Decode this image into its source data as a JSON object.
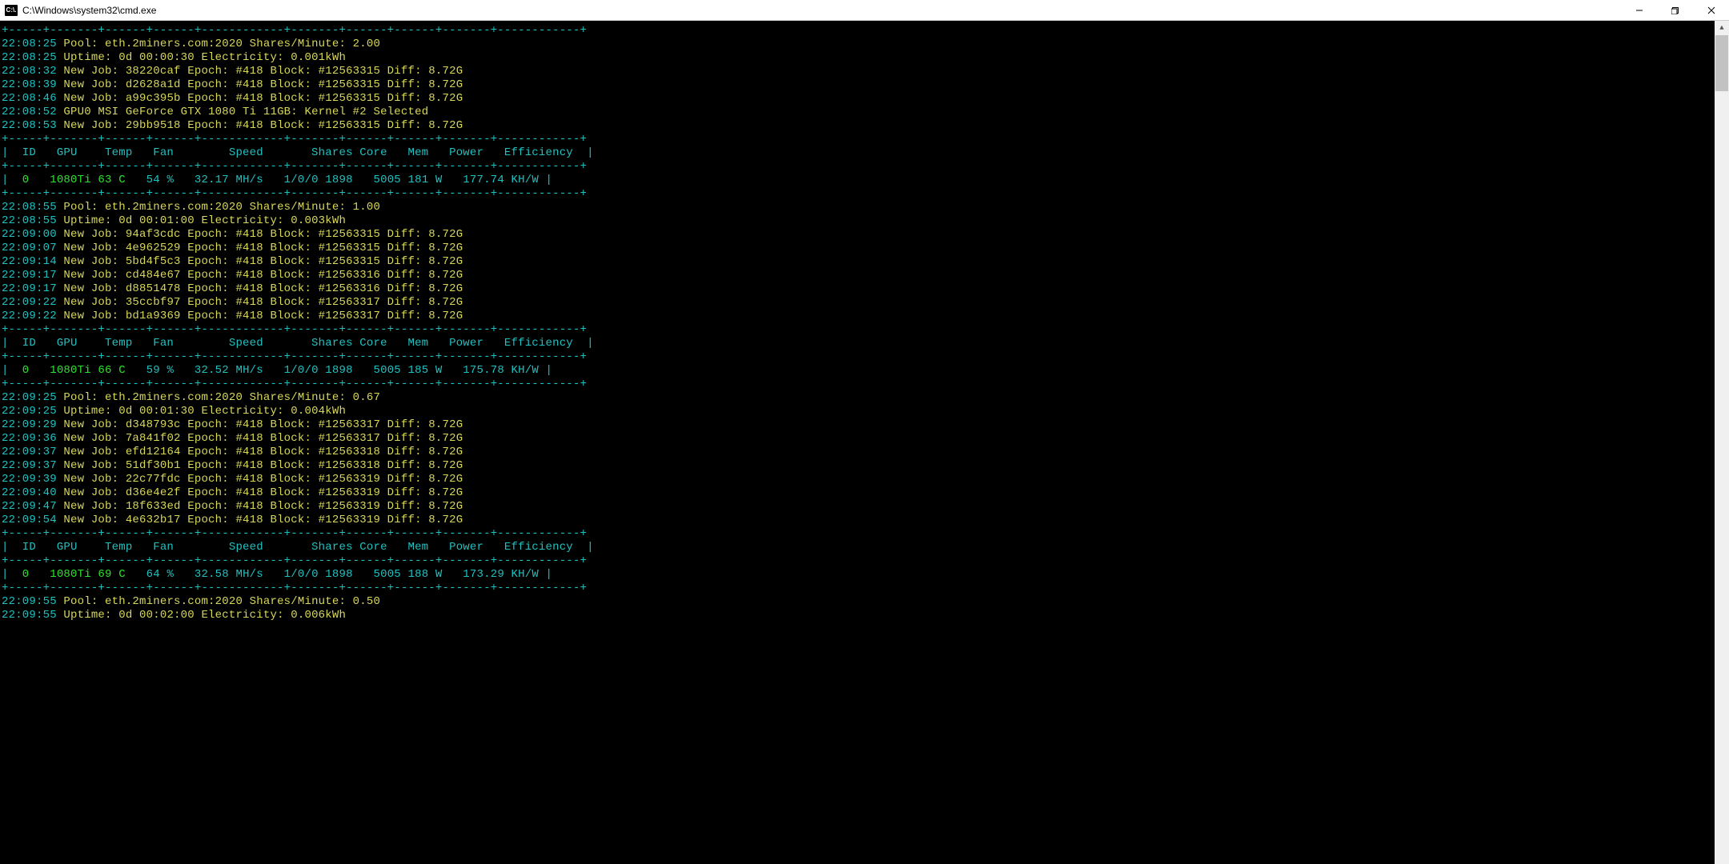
{
  "window": {
    "icon_text": "C:\\.",
    "title": "C:\\Windows\\system32\\cmd.exe"
  },
  "tableBorder": {
    "top": "+-----+-------+------+------+------------+-------+------+------+-------+------------+",
    "header": "|  ID   GPU    Temp   Fan        Speed       Shares Core   Mem   Power   Efficiency  |",
    "mid": "+-----+-------+------+------+------------+-------+------+------+-------+------------+",
    "bot": "+-----+-------+------+------+------------+-------+------+------+-------+------------+"
  },
  "segments": [
    {
      "pool": {
        "ts": "22:08:25",
        "text": "Pool: eth.2miners.com:2020 Shares/Minute: 2.00"
      },
      "uptime": {
        "ts": "22:08:25",
        "text": "Uptime: 0d 00:00:30 Electricity: 0.001kWh"
      },
      "jobs": [
        {
          "ts": "22:08:32",
          "text": "New Job: 38220caf Epoch: #418 Block: #12563315 Diff: 8.72G"
        },
        {
          "ts": "22:08:39",
          "text": "New Job: d2628a1d Epoch: #418 Block: #12563315 Diff: 8.72G"
        },
        {
          "ts": "22:08:46",
          "text": "New Job: a99c395b Epoch: #418 Block: #12563315 Diff: 8.72G"
        },
        {
          "ts": "22:08:52",
          "text": "GPU0 MSI GeForce GTX 1080 Ti 11GB: Kernel #2 Selected"
        },
        {
          "ts": "22:08:53",
          "text": "New Job: 29bb9518 Epoch: #418 Block: #12563315 Diff: 8.72G"
        }
      ],
      "row": {
        "id": "0",
        "gpu": "1080Ti",
        "temp": "63 C",
        "fan": "54 %",
        "speed": "32.17 MH/s",
        "shares": "1/0/0",
        "core": "1898",
        "mem": "5005",
        "power": "181 W",
        "eff": "177.74 KH/W"
      }
    },
    {
      "pool": {
        "ts": "22:08:55",
        "text": "Pool: eth.2miners.com:2020 Shares/Minute: 1.00"
      },
      "uptime": {
        "ts": "22:08:55",
        "text": "Uptime: 0d 00:01:00 Electricity: 0.003kWh"
      },
      "jobs": [
        {
          "ts": "22:09:00",
          "text": "New Job: 94af3cdc Epoch: #418 Block: #12563315 Diff: 8.72G"
        },
        {
          "ts": "22:09:07",
          "text": "New Job: 4e962529 Epoch: #418 Block: #12563315 Diff: 8.72G"
        },
        {
          "ts": "22:09:14",
          "text": "New Job: 5bd4f5c3 Epoch: #418 Block: #12563315 Diff: 8.72G"
        },
        {
          "ts": "22:09:17",
          "text": "New Job: cd484e67 Epoch: #418 Block: #12563316 Diff: 8.72G"
        },
        {
          "ts": "22:09:17",
          "text": "New Job: d8851478 Epoch: #418 Block: #12563316 Diff: 8.72G"
        },
        {
          "ts": "22:09:22",
          "text": "New Job: 35ccbf97 Epoch: #418 Block: #12563317 Diff: 8.72G"
        },
        {
          "ts": "22:09:22",
          "text": "New Job: bd1a9369 Epoch: #418 Block: #12563317 Diff: 8.72G"
        }
      ],
      "row": {
        "id": "0",
        "gpu": "1080Ti",
        "temp": "66 C",
        "fan": "59 %",
        "speed": "32.52 MH/s",
        "shares": "1/0/0",
        "core": "1898",
        "mem": "5005",
        "power": "185 W",
        "eff": "175.78 KH/W"
      }
    },
    {
      "pool": {
        "ts": "22:09:25",
        "text": "Pool: eth.2miners.com:2020 Shares/Minute: 0.67"
      },
      "uptime": {
        "ts": "22:09:25",
        "text": "Uptime: 0d 00:01:30 Electricity: 0.004kWh"
      },
      "jobs": [
        {
          "ts": "22:09:29",
          "text": "New Job: d348793c Epoch: #418 Block: #12563317 Diff: 8.72G"
        },
        {
          "ts": "22:09:36",
          "text": "New Job: 7a841f02 Epoch: #418 Block: #12563317 Diff: 8.72G"
        },
        {
          "ts": "22:09:37",
          "text": "New Job: efd12164 Epoch: #418 Block: #12563318 Diff: 8.72G"
        },
        {
          "ts": "22:09:37",
          "text": "New Job: 51df30b1 Epoch: #418 Block: #12563318 Diff: 8.72G"
        },
        {
          "ts": "22:09:39",
          "text": "New Job: 22c77fdc Epoch: #418 Block: #12563319 Diff: 8.72G"
        },
        {
          "ts": "22:09:40",
          "text": "New Job: d36e4e2f Epoch: #418 Block: #12563319 Diff: 8.72G"
        },
        {
          "ts": "22:09:47",
          "text": "New Job: 18f633ed Epoch: #418 Block: #12563319 Diff: 8.72G"
        },
        {
          "ts": "22:09:54",
          "text": "New Job: 4e632b17 Epoch: #418 Block: #12563319 Diff: 8.72G"
        }
      ],
      "row": {
        "id": "0",
        "gpu": "1080Ti",
        "temp": "69 C",
        "fan": "64 %",
        "speed": "32.58 MH/s",
        "shares": "1/0/0",
        "core": "1898",
        "mem": "5005",
        "power": "188 W",
        "eff": "173.29 KH/W"
      }
    },
    {
      "pool": {
        "ts": "22:09:55",
        "text": "Pool: eth.2miners.com:2020 Shares/Minute: 0.50"
      },
      "uptime": {
        "ts": "22:09:55",
        "text": "Uptime: 0d 00:02:00 Electricity: 0.006kWh"
      }
    }
  ]
}
